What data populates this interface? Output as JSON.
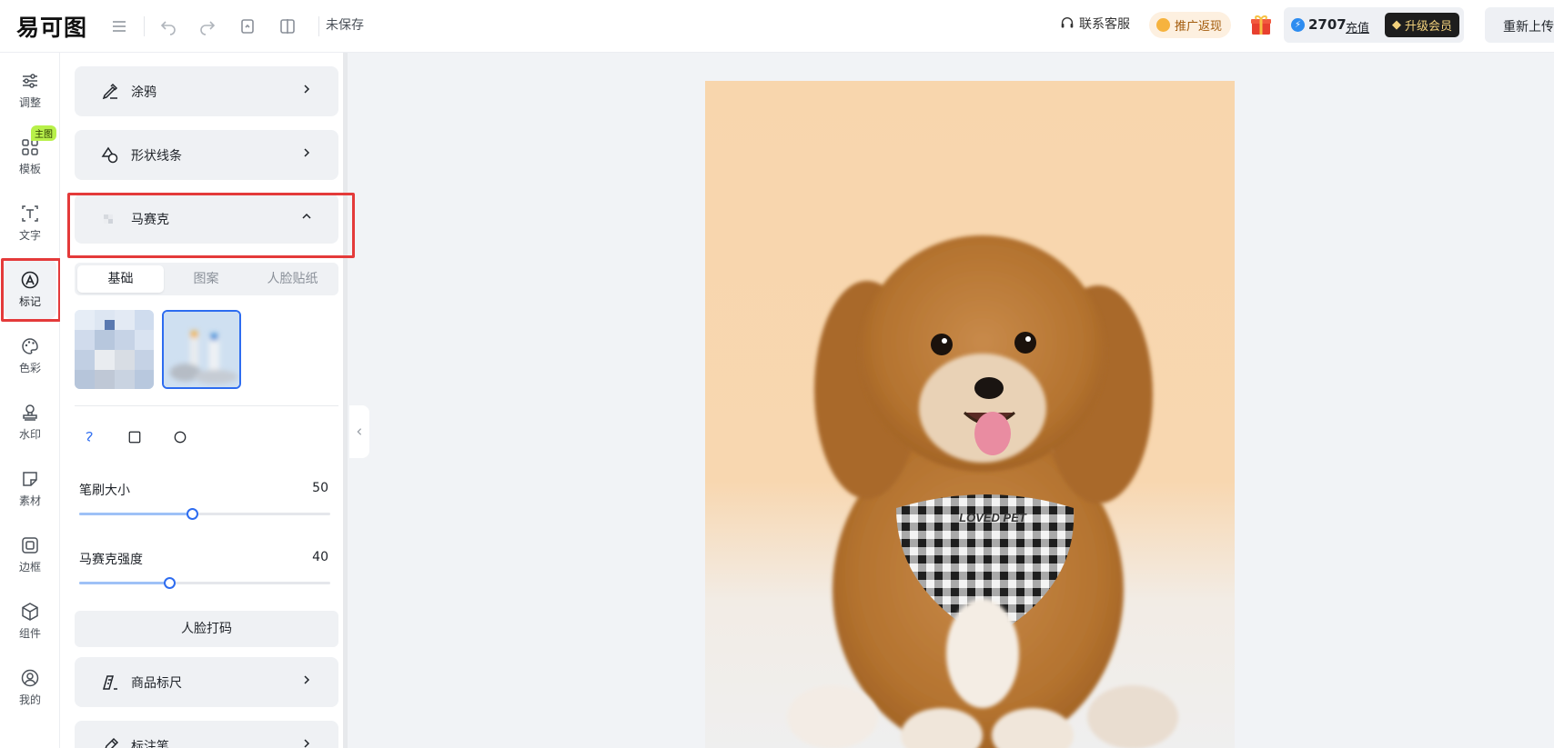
{
  "topbar": {
    "logo": "易可图",
    "unsaved": "未保存",
    "service": "联系客服",
    "promo": "推广返现",
    "points": "2707",
    "recharge": "充值",
    "vip": "升级会员",
    "reupload": "重新上传"
  },
  "nav": {
    "adjust": "调整",
    "template": "模板",
    "template_badge": "主图",
    "text": "文字",
    "mark": "标记",
    "color": "色彩",
    "watermark": "水印",
    "material": "素材",
    "border": "边框",
    "component": "组件",
    "mine": "我的"
  },
  "panel": {
    "graffiti": "涂鸦",
    "shape_lines": "形状线条",
    "mosaic": "马赛克",
    "tabs": [
      "基础",
      "图案",
      "人脸贴纸"
    ],
    "brush_size_label": "笔刷大小",
    "brush_size_value": "50",
    "mosaic_strength_label": "马赛克强度",
    "mosaic_strength_value": "40",
    "face_mosaic": "人脸打码",
    "product_ruler": "商品标尺",
    "annotation_tool": "标注笔"
  },
  "photo": {
    "bib_text": "LOVED PET"
  },
  "sliders": {
    "brush_size": 0.45,
    "mosaic_strength": 0.36
  },
  "colors": {
    "accent": "#2d6cf0",
    "highlight": "#e43a3a",
    "badge": "#b8f04a"
  }
}
